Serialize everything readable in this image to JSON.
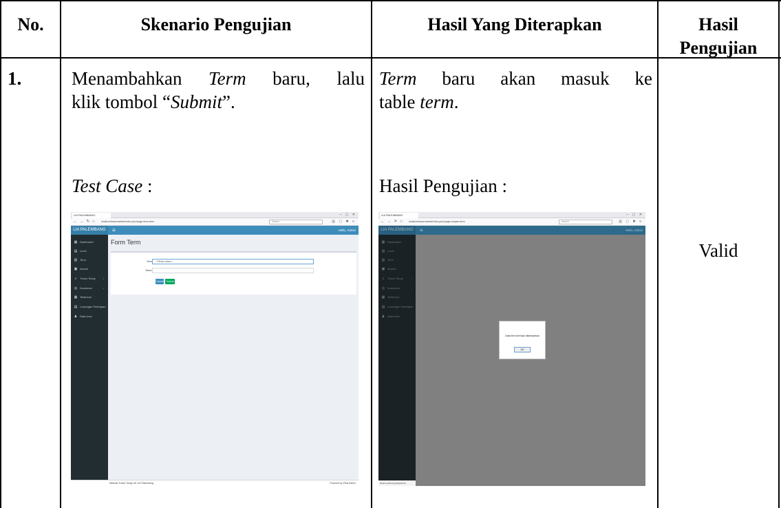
{
  "table": {
    "headers": {
      "no": "No.",
      "skenario": "Skenario Pengujian",
      "hasil_diterapkan": "Hasil Yang Diterapkan",
      "hasil_pengujian_1": "Hasil",
      "hasil_pengujian_2": "Pengujian"
    },
    "row": {
      "no": "1.",
      "skenario_pre": "Menambahkan ",
      "skenario_term": "Term",
      "skenario_mid": " baru, lalu",
      "skenario_line2_pre": "klik tombol “",
      "skenario_submit": "Submit",
      "skenario_line2_post": "”.",
      "test_case": "Test Case",
      "test_case_colon": " :",
      "diterapkan_term": "Term",
      "diterapkan_mid": " baru akan masuk ke",
      "diterapkan_line2_pre": "table ",
      "diterapkan_line2_term": "term",
      "diterapkan_line2_post": ".",
      "hasil_label": "Hasil Pengujian :",
      "result": "Valid"
    }
  },
  "screenshot_left": {
    "tab_title": "LIA PALEMBANG",
    "url": "localhost/tracer/admin/index.php?page=form-term",
    "search_placeholder": "Search",
    "brand": "LIA PALEMBANG",
    "greeting": "Hello, Admin",
    "sidebar": [
      {
        "icon": "dashboard-icon",
        "glyph": "▦",
        "label": "Dashboard",
        "arrow": ""
      },
      {
        "icon": "level-icon",
        "glyph": "▤",
        "label": "Level",
        "arrow": ""
      },
      {
        "icon": "term-icon",
        "glyph": "▥",
        "label": "Term",
        "arrow": ""
      },
      {
        "icon": "alumni-icon",
        "glyph": "▣",
        "label": "Alumni",
        "arrow": ""
      },
      {
        "icon": "tracer-study-icon",
        "glyph": "⌕",
        "label": "Tracer Study",
        "arrow": "‹"
      },
      {
        "icon": "kuesioner-icon",
        "glyph": "◎",
        "label": "Kuesioner",
        "arrow": "‹"
      },
      {
        "icon": "testimoni-icon",
        "glyph": "▦",
        "label": "Testimoni",
        "arrow": ""
      },
      {
        "icon": "lowongan-icon",
        "glyph": "▤",
        "label": "Lowongan Pekerjaan",
        "arrow": ""
      },
      {
        "icon": "data-user-icon",
        "glyph": "♟",
        "label": "Data User",
        "arrow": ""
      }
    ],
    "page_title": "Form Term",
    "field_term_label": "Term",
    "field_term_value": "-- Please select --",
    "field_tahun_label": "Tahun",
    "cancel_label": "Cancel",
    "submit_label": "Submit",
    "footer_left": "Website Tracer Study UE LIA Palembang",
    "footer_right": "Powered by Pikal Admin",
    "colors": {
      "header": "#3c8dbc",
      "sidebar": "#222d32",
      "submit": "#00a65a",
      "cancel": "#3c8dbc"
    }
  },
  "screenshot_right": {
    "tab_title": "LIA PALEMBANG",
    "url": "localhost/tracer/admin/index.php?page=simpan-term",
    "search_placeholder": "Search",
    "brand": "LIA PALEMBANG",
    "greeting": "Hello, Admin",
    "dialog_message": "Data term berhasil ditambahkan",
    "dialog_ok": "OK",
    "status_text": "Read localhost:phpMyAdmin"
  }
}
